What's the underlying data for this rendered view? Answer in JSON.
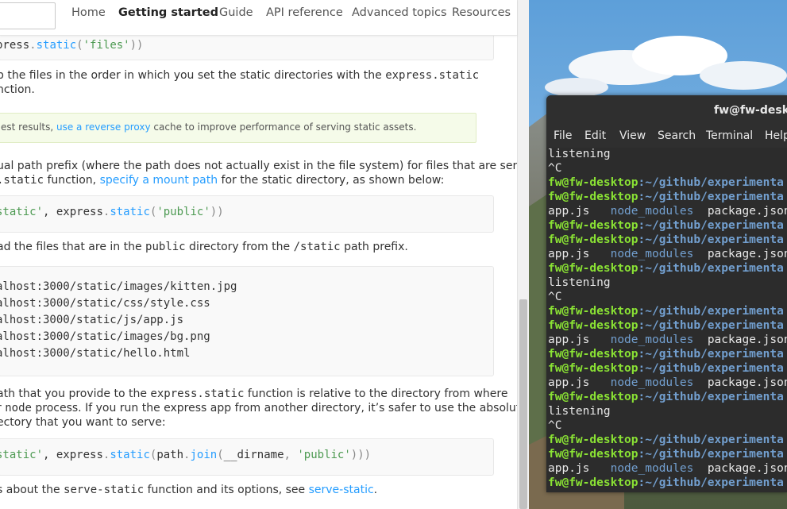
{
  "browser": {
    "nav": [
      "Home",
      "Getting started",
      "Guide",
      "API reference",
      "Advanced topics",
      "Resources"
    ],
    "code1": {
      "pre": "press",
      "dot": ".",
      "fn": "static",
      "open": "(",
      "str": "'files'",
      "close": "))"
    },
    "p1": {
      "a": "p the files in the order in which you set the static directories with the ",
      "code": "express.static",
      "b": "nction."
    },
    "tip": {
      "a": "est results, ",
      "link": "use a reverse proxy",
      "b": " cache to improve performance of serving static assets."
    },
    "p2": {
      "a": "ual path prefix (where the path does not actually exist in the file system) for files that are served",
      "code": ".static",
      "b": " function, ",
      "link": "specify a mount path",
      "c": " for the static directory, as shown below:"
    },
    "code2": {
      "str": "static'",
      "mid": ", express",
      "dot": ".",
      "fn": "static",
      "open": "(",
      "arg": "'public'",
      "close": "))"
    },
    "p3": {
      "a": "ad the files that are in the ",
      "c1": "public",
      "b": " directory from the ",
      "c2": "/static",
      "c": " path prefix."
    },
    "urls": [
      "alhost:3000/static/images/kitten.jpg",
      "alhost:3000/static/css/style.css",
      "alhost:3000/static/js/app.js",
      "alhost:3000/static/images/bg.png",
      "alhost:3000/static/hello.html"
    ],
    "p4": {
      "a": "ath that you provide to the ",
      "code": "express.static",
      "b": " function is relative to the directory from where",
      "c": "r ",
      "code2": "node",
      "d": " process. If you run the express app from another directory, it’s safer to use the absolute",
      "e": "ectory that you want to serve:"
    },
    "code3": {
      "str": "static'",
      "mid": ", express",
      "dot": ".",
      "fn": "static",
      "open": "(",
      "path": "path",
      "dot2": ".",
      "join": "join",
      "open2": "(",
      "dirname": "__dirname",
      "comma": ", ",
      "arg": "'public'",
      "close": ")))"
    },
    "p5": {
      "a": "s about the ",
      "code": "serve-static",
      "b": " function and its options, see ",
      "link": "serve-static",
      "c": "."
    }
  },
  "terminal": {
    "title": "fw@fw-deskt",
    "menu": [
      "File",
      "Edit",
      "View",
      "Search",
      "Terminal",
      "Help"
    ],
    "prompt_user": "fw@fw-desktop",
    "prompt_path": ":~/github/experimenta",
    "ls": {
      "file1": "app.js",
      "dir": "node_modules",
      "file2": "package.json"
    },
    "listening": "listening",
    "ctrl_c": "^C"
  },
  "colors": {
    "link": "#259dff",
    "string": "#4d9a52",
    "prompt_user": "#8ae234",
    "prompt_path": "#729fcf",
    "terminal_bg": "#2c2c2c"
  }
}
